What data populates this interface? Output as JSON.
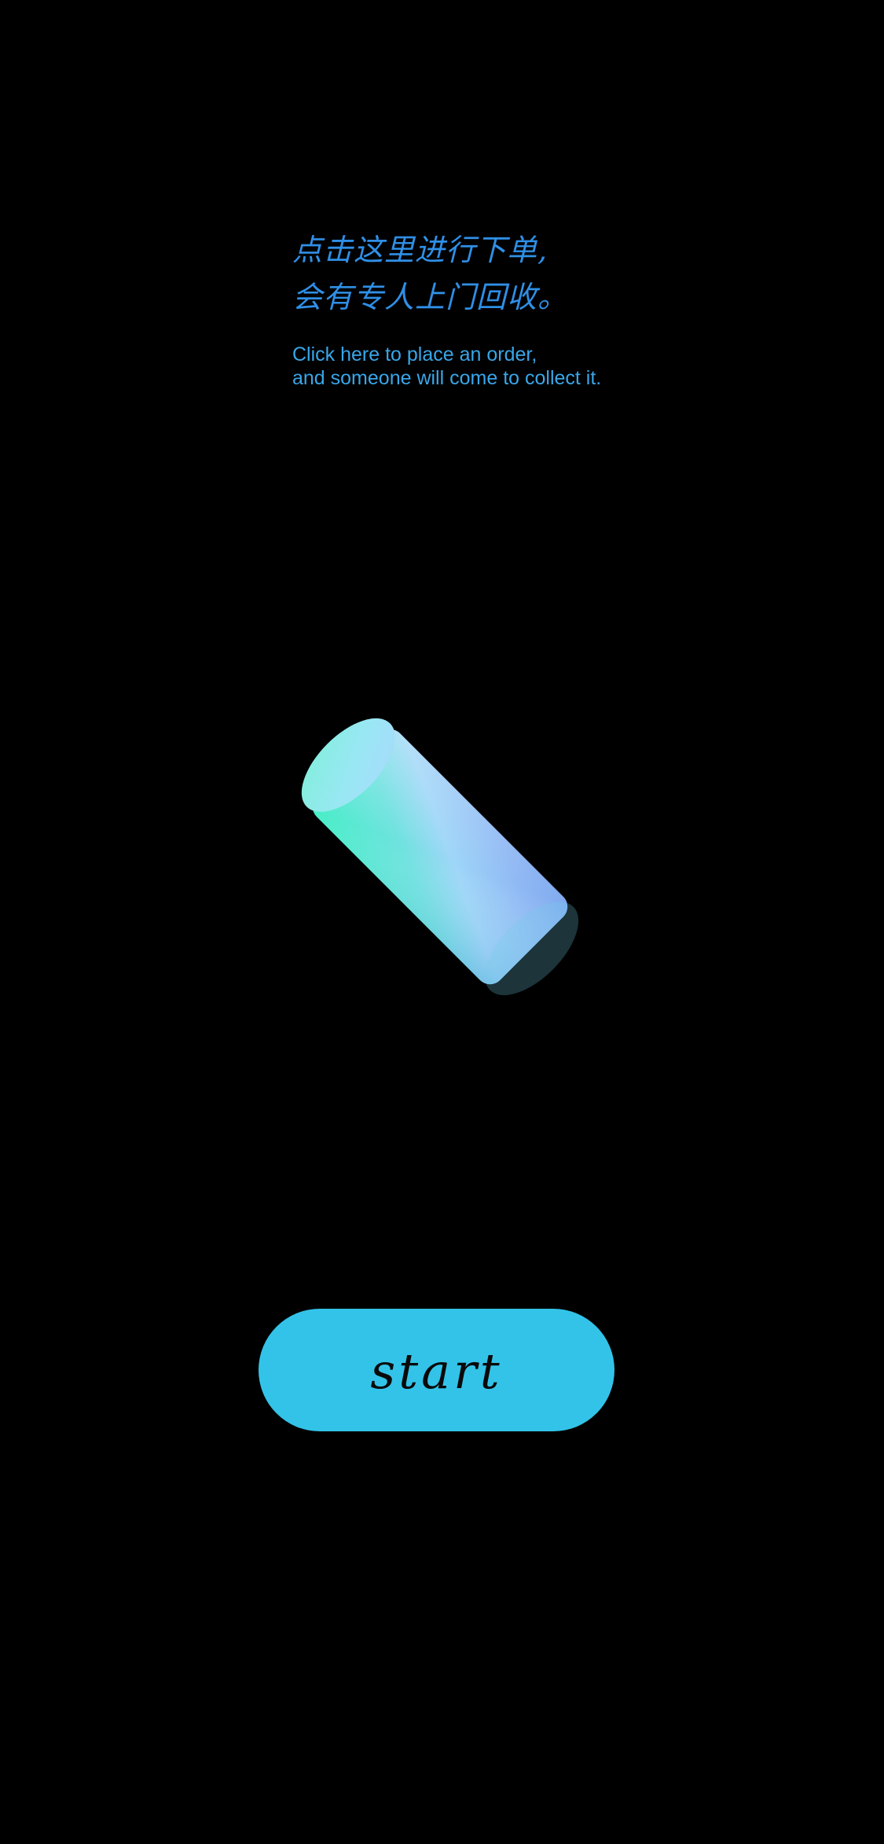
{
  "instructions": {
    "zh_line_1": "点击这里进行下单,",
    "zh_line_2": "会有专人上门回收。",
    "en_line_1": "Click here to place an order,",
    "en_line_2": "and someone will come to collect it."
  },
  "illustration": {
    "icon": "cylinder-3d-icon",
    "colors": {
      "top": "#8fe9f6",
      "body_light": "#9fd8f8",
      "body_blue": "#7fb0f2",
      "body_green": "#49e8c7"
    }
  },
  "start_button": {
    "label": "start",
    "color": "#33c3e8"
  },
  "theme": {
    "background": "#000000",
    "text_blue": "#2f8fe6",
    "text_light_blue": "#39a6e8"
  }
}
